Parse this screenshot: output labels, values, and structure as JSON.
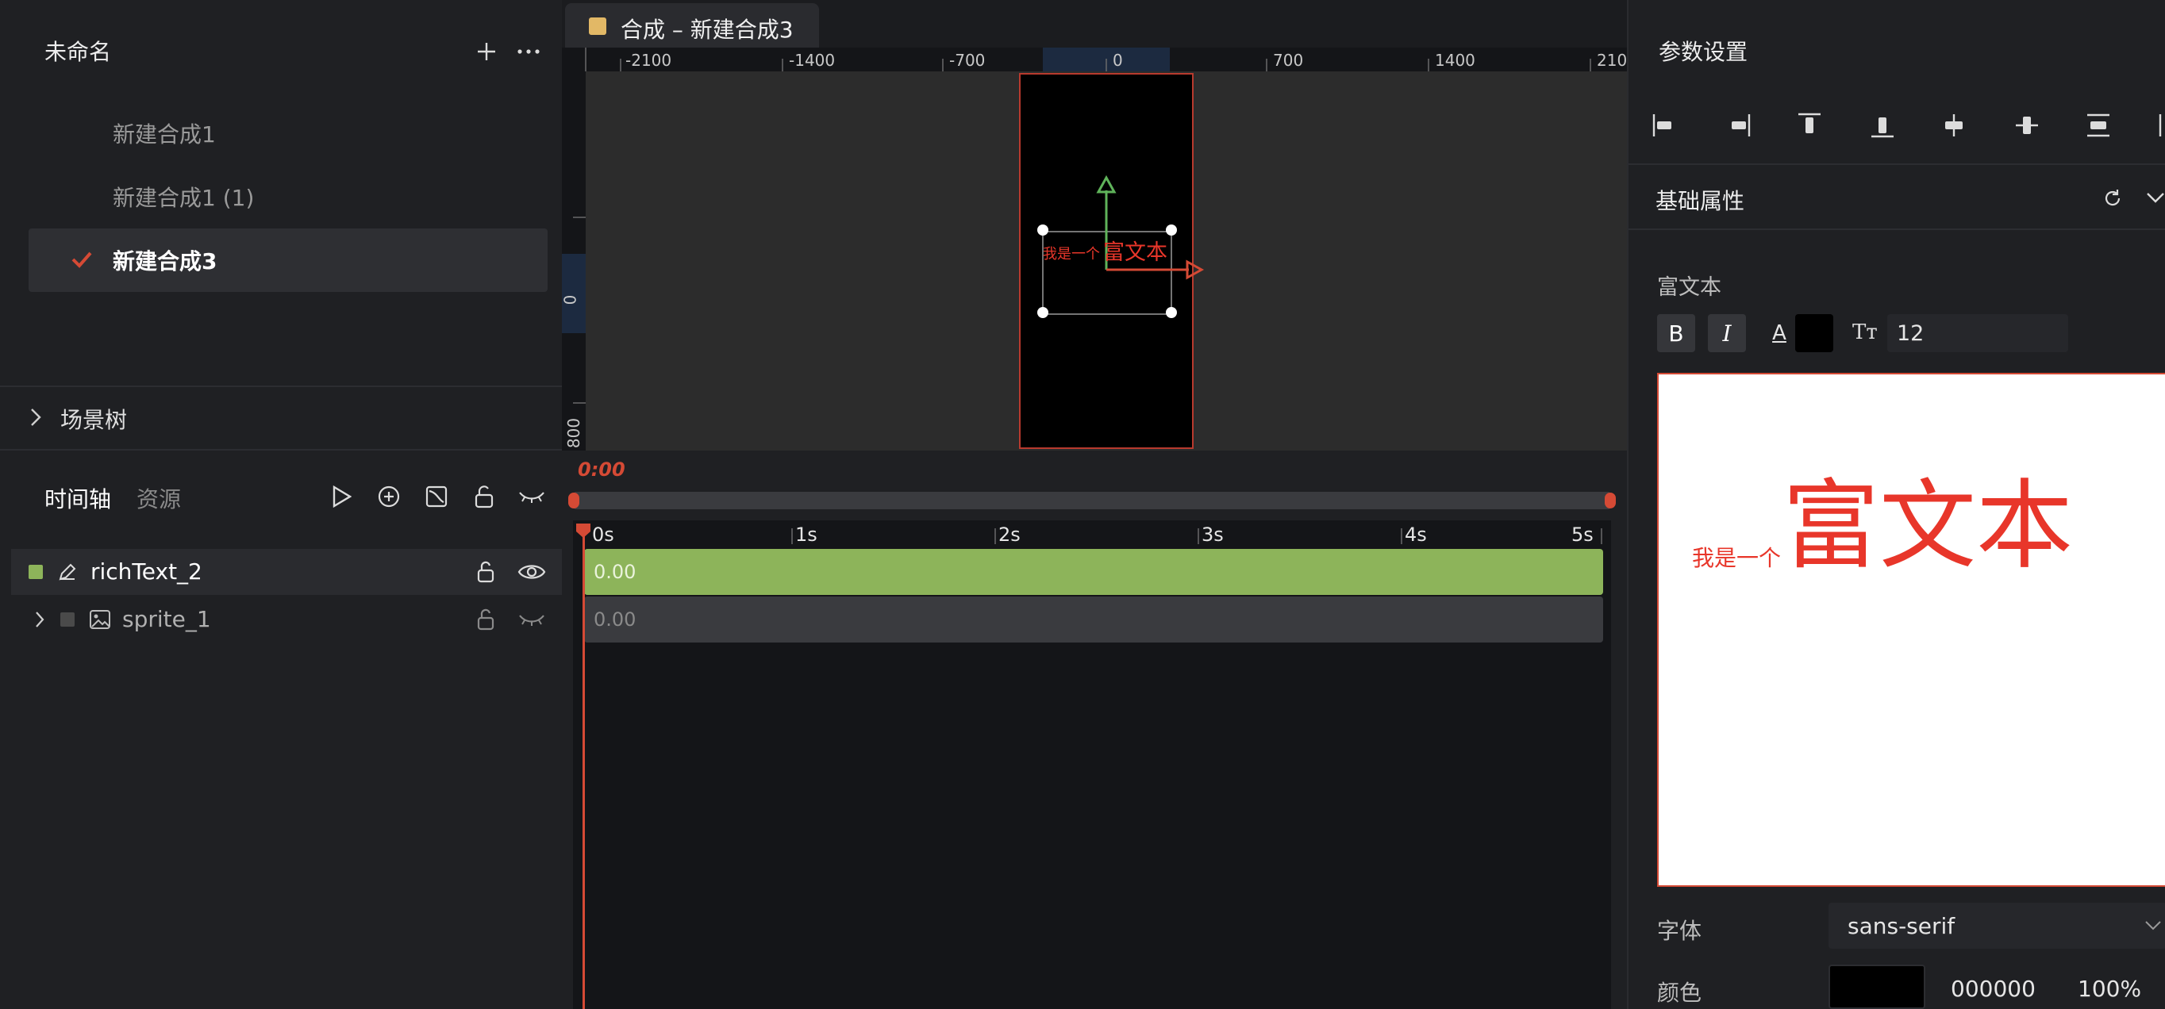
{
  "project": {
    "title": "未命名",
    "compositions": [
      {
        "label": "新建合成1",
        "active": false
      },
      {
        "label": "新建合成1 (1)",
        "active": false
      },
      {
        "label": "新建合成3",
        "active": true
      }
    ],
    "scene_tree_label": "场景树"
  },
  "timeline_panel": {
    "tabs": [
      "时间轴",
      "资源"
    ],
    "layers": [
      {
        "name": "richText_2",
        "color": "#8db45a",
        "selected": true
      },
      {
        "name": "sprite_1",
        "color": "#4a4a4a",
        "selected": false
      }
    ]
  },
  "editor": {
    "tab_label": "合成 – 新建合成3",
    "ruler_h": [
      "-2100",
      "-1400",
      "-700",
      "0",
      "700",
      "1400",
      "210"
    ],
    "ruler_v": [
      "0",
      "800"
    ],
    "artboard_small_text": "我是一个",
    "artboard_big_text": "富文本",
    "time_readout": "0:00",
    "time_ticks": [
      "0s",
      "1s",
      "2s",
      "3s",
      "4s",
      "5s"
    ],
    "tracks": [
      {
        "value": "0.00",
        "color": "#8db45a"
      },
      {
        "value": "0.00",
        "color": "#3a3b3f"
      }
    ]
  },
  "params": {
    "title": "参数设置",
    "section_title": "基础属性",
    "rich_text_label": "富文本",
    "format": {
      "bold": "B",
      "italic": "I",
      "color_letter": "A",
      "size_icon": "Tт",
      "font_size": "12"
    },
    "preview_small": "我是一个",
    "preview_big": "富文本",
    "font_label": "字体",
    "font_value": "sans-serif",
    "color_label": "颜色",
    "color_hex": "000000",
    "color_alpha": "100%"
  },
  "colors": {
    "accent": "#d54a35",
    "green": "#8db45a",
    "gold": "#e2b866"
  }
}
